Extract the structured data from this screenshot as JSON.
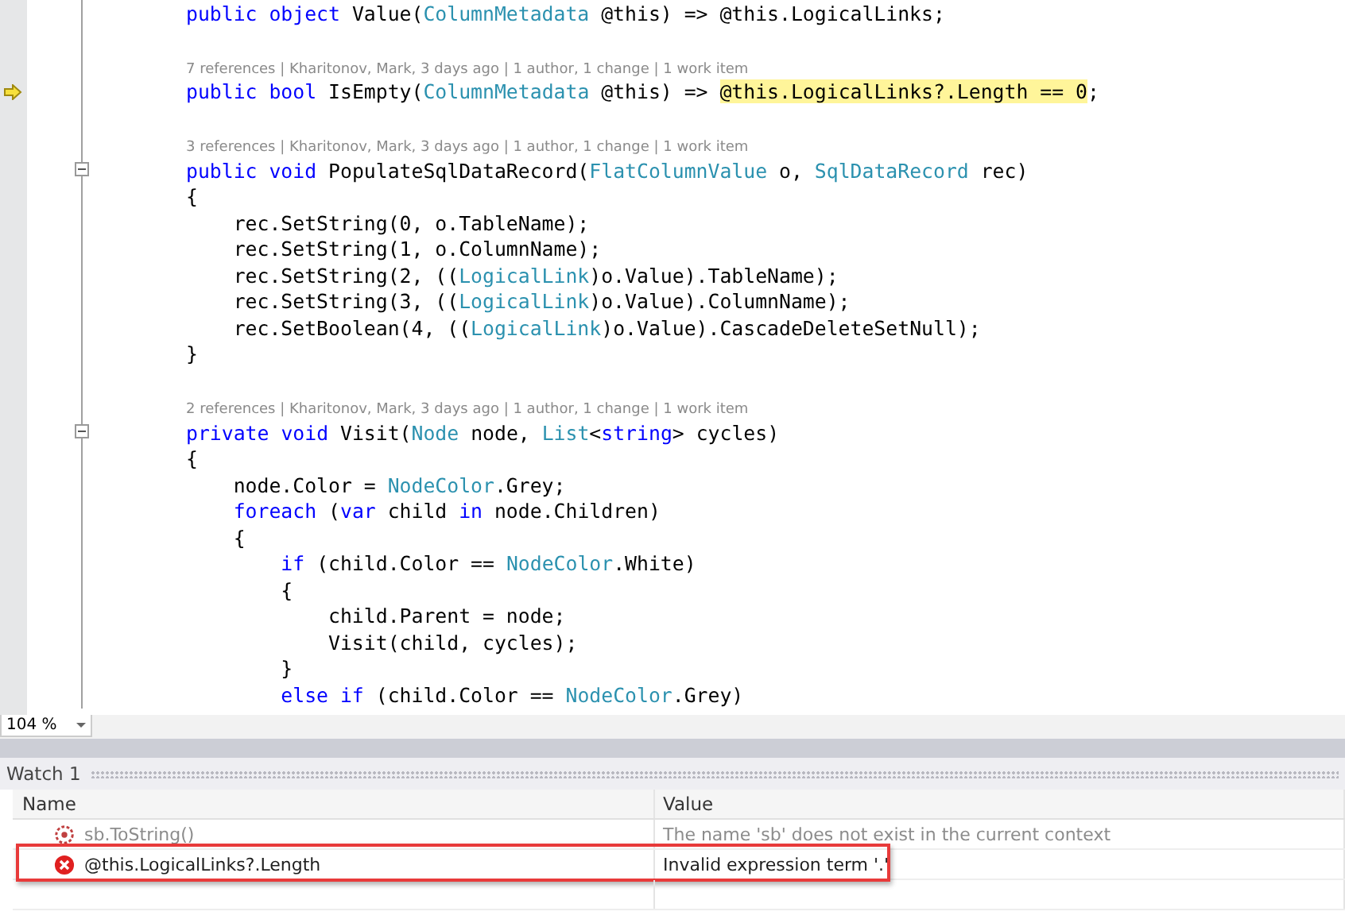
{
  "editor": {
    "lines": [
      {
        "kind": "code",
        "tokens": [
          {
            "kind": "kw",
            "t": "public "
          },
          {
            "kind": "kw",
            "t": "object "
          },
          {
            "kind": "id",
            "t": "Value("
          },
          {
            "kind": "type",
            "t": "ColumnMetadata"
          },
          {
            "kind": "id",
            "t": " @this) => @this.LogicalLinks;"
          }
        ]
      },
      {
        "kind": "blank"
      },
      {
        "kind": "lens",
        "text": "7 references | Kharitonov, Mark, 3 days ago | 1 author, 1 change | 1 work item"
      },
      {
        "kind": "code",
        "current": true,
        "tokens": [
          {
            "kind": "kw",
            "t": "public "
          },
          {
            "kind": "kw",
            "t": "bool "
          },
          {
            "kind": "id",
            "t": "IsEmpty("
          },
          {
            "kind": "type",
            "t": "ColumnMetadata"
          },
          {
            "kind": "id",
            "t": " @this) => "
          },
          {
            "kind": "hl",
            "t": "@this.LogicalLinks?.Length == 0"
          },
          {
            "kind": "id",
            "t": ";"
          }
        ]
      },
      {
        "kind": "blank"
      },
      {
        "kind": "lens",
        "text": "3 references | Kharitonov, Mark, 3 days ago | 1 author, 1 change | 1 work item"
      },
      {
        "kind": "code",
        "fold": true,
        "tokens": [
          {
            "kind": "kw",
            "t": "public "
          },
          {
            "kind": "kw",
            "t": "void "
          },
          {
            "kind": "id",
            "t": "PopulateSqlDataRecord("
          },
          {
            "kind": "type",
            "t": "FlatColumnValue"
          },
          {
            "kind": "id",
            "t": " o, "
          },
          {
            "kind": "type",
            "t": "SqlDataRecord"
          },
          {
            "kind": "id",
            "t": " rec)"
          }
        ]
      },
      {
        "kind": "code",
        "tokens": [
          {
            "kind": "id",
            "t": "{"
          }
        ]
      },
      {
        "kind": "code",
        "tokens": [
          {
            "kind": "id",
            "t": "    rec.SetString(0, o.TableName);"
          }
        ]
      },
      {
        "kind": "code",
        "tokens": [
          {
            "kind": "id",
            "t": "    rec.SetString(1, o.ColumnName);"
          }
        ]
      },
      {
        "kind": "code",
        "tokens": [
          {
            "kind": "id",
            "t": "    rec.SetString(2, (("
          },
          {
            "kind": "type",
            "t": "LogicalLink"
          },
          {
            "kind": "id",
            "t": ")o.Value).TableName);"
          }
        ]
      },
      {
        "kind": "code",
        "tokens": [
          {
            "kind": "id",
            "t": "    rec.SetString(3, (("
          },
          {
            "kind": "type",
            "t": "LogicalLink"
          },
          {
            "kind": "id",
            "t": ")o.Value).ColumnName);"
          }
        ]
      },
      {
        "kind": "code",
        "tokens": [
          {
            "kind": "id",
            "t": "    rec.SetBoolean(4, (("
          },
          {
            "kind": "type",
            "t": "LogicalLink"
          },
          {
            "kind": "id",
            "t": ")o.Value).CascadeDeleteSetNull);"
          }
        ]
      },
      {
        "kind": "code",
        "tokens": [
          {
            "kind": "id",
            "t": "}"
          }
        ]
      },
      {
        "kind": "blank"
      },
      {
        "kind": "lens",
        "text": "2 references | Kharitonov, Mark, 3 days ago | 1 author, 1 change | 1 work item"
      },
      {
        "kind": "code",
        "fold": true,
        "tokens": [
          {
            "kind": "kw",
            "t": "private "
          },
          {
            "kind": "kw",
            "t": "void "
          },
          {
            "kind": "id",
            "t": "Visit("
          },
          {
            "kind": "type",
            "t": "Node"
          },
          {
            "kind": "id",
            "t": " node, "
          },
          {
            "kind": "type",
            "t": "List"
          },
          {
            "kind": "id",
            "t": "<"
          },
          {
            "kind": "kw",
            "t": "string"
          },
          {
            "kind": "id",
            "t": "> cycles)"
          }
        ]
      },
      {
        "kind": "code",
        "tokens": [
          {
            "kind": "id",
            "t": "{"
          }
        ]
      },
      {
        "kind": "code",
        "tokens": [
          {
            "kind": "id",
            "t": "    node.Color = "
          },
          {
            "kind": "type",
            "t": "NodeColor"
          },
          {
            "kind": "id",
            "t": ".Grey;"
          }
        ]
      },
      {
        "kind": "code",
        "tokens": [
          {
            "kind": "kw",
            "t": "    foreach"
          },
          {
            "kind": "id",
            "t": " ("
          },
          {
            "kind": "kw",
            "t": "var"
          },
          {
            "kind": "id",
            "t": " child "
          },
          {
            "kind": "kw",
            "t": "in"
          },
          {
            "kind": "id",
            "t": " node.Children)"
          }
        ]
      },
      {
        "kind": "code",
        "tokens": [
          {
            "kind": "id",
            "t": "    {"
          }
        ]
      },
      {
        "kind": "code",
        "tokens": [
          {
            "kind": "kw",
            "t": "        if"
          },
          {
            "kind": "id",
            "t": " (child.Color == "
          },
          {
            "kind": "type",
            "t": "NodeColor"
          },
          {
            "kind": "id",
            "t": ".White)"
          }
        ]
      },
      {
        "kind": "code",
        "tokens": [
          {
            "kind": "id",
            "t": "        {"
          }
        ]
      },
      {
        "kind": "code",
        "tokens": [
          {
            "kind": "id",
            "t": "            child.Parent = node;"
          }
        ]
      },
      {
        "kind": "code",
        "tokens": [
          {
            "kind": "id",
            "t": "            Visit(child, cycles);"
          }
        ]
      },
      {
        "kind": "code",
        "tokens": [
          {
            "kind": "id",
            "t": "        }"
          }
        ]
      },
      {
        "kind": "code",
        "tokens": [
          {
            "kind": "kw",
            "t": "        else if"
          },
          {
            "kind": "id",
            "t": " (child.Color == "
          },
          {
            "kind": "type",
            "t": "NodeColor"
          },
          {
            "kind": "id",
            "t": ".Grey)"
          }
        ]
      }
    ],
    "zoom": "104 %"
  },
  "watch": {
    "title": "Watch 1",
    "columns": [
      "Name",
      "Value"
    ],
    "rows": [
      {
        "kind": "stale",
        "name": "sb.ToString()",
        "value": "The name 'sb' does not exist in the current context",
        "highlighted": false
      },
      {
        "kind": "error",
        "name": "@this.LogicalLinks?.Length",
        "value": "Invalid expression term '.'",
        "highlighted": true
      }
    ]
  }
}
